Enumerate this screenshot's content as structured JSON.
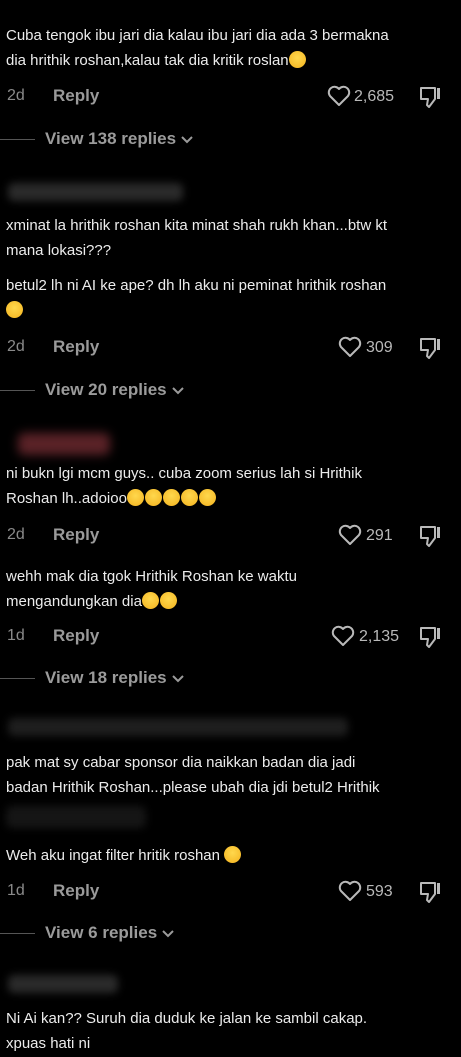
{
  "colors": {
    "background": "#000000",
    "text": "#ececec",
    "muted": "#8a8a8a"
  },
  "comments": [
    {
      "lines": [
        "Cuba tengok ibu jari dia kalau ibu jari dia ada 3 bermakna",
        "dia hrithik roshan,kalau tak dia kritik roslan"
      ],
      "emojis": [
        "rofl"
      ],
      "time": "2d",
      "reply": "Reply",
      "likes": "2,685",
      "view_replies": "View 138 replies"
    },
    {
      "lines": [
        "xminat la hrithik roshan kita minat shah rukh khan...btw kt",
        "mana lokasi???"
      ],
      "emojis": []
    },
    {
      "lines": [
        "betul2 lh ni AI ke ape? dh lh aku ni peminat hrithik roshan"
      ],
      "emojis": [
        "relieved"
      ],
      "time": "2d",
      "reply": "Reply",
      "likes": "309",
      "view_replies": "View 20 replies"
    },
    {
      "lines": [
        "ni bukn lgi mcm guys.. cuba zoom serius lah si Hrithik",
        "Roshan lh..adoioo"
      ],
      "emojis": [
        "relieved",
        "relieved",
        "relieved",
        "relieved",
        "relieved"
      ],
      "time": "2d",
      "reply": "Reply",
      "likes": "291"
    },
    {
      "lines": [
        "wehh mak dia tgok Hrithik Roshan ke waktu",
        "mengandungkan dia"
      ],
      "emojis": [
        "rofl",
        "rofl"
      ],
      "time": "1d",
      "reply": "Reply",
      "likes": "2,135",
      "view_replies": "View 18 replies"
    },
    {
      "lines": [
        "pak mat sy cabar sponsor dia naikkan badan dia jadi",
        "badan Hrithik Roshan...please ubah dia jdi betul2 Hrithik"
      ],
      "emojis": []
    },
    {
      "lines": [
        "Weh aku ingat filter hritik roshan"
      ],
      "emojis": [
        "crying"
      ],
      "time": "1d",
      "reply": "Reply",
      "likes": "593",
      "view_replies": "View 6 replies"
    },
    {
      "lines": [
        "Ni Ai kan?? Suruh dia duduk ke jalan ke sambil cakap.",
        "xpuas hati ni"
      ],
      "emojis": []
    }
  ]
}
